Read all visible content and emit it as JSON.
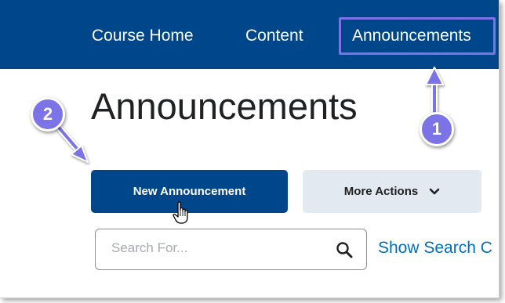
{
  "nav": {
    "items": [
      {
        "label": "Course Home"
      },
      {
        "label": "Content"
      },
      {
        "label": "Announcements"
      }
    ]
  },
  "page": {
    "title": "Announcements"
  },
  "actions": {
    "new_announcement_label": "New Announcement",
    "more_actions_label": "More Actions"
  },
  "search": {
    "placeholder": "Search For...",
    "value": "",
    "options_link_label": "Show Search C"
  },
  "callouts": [
    {
      "number": "1"
    },
    {
      "number": "2"
    }
  ],
  "colors": {
    "nav_background": "#00468a",
    "primary_button": "#00468a",
    "secondary_button": "#e3e9f1",
    "callout_accent": "#7b73e6",
    "link": "#006fbf",
    "text": "#202122"
  }
}
